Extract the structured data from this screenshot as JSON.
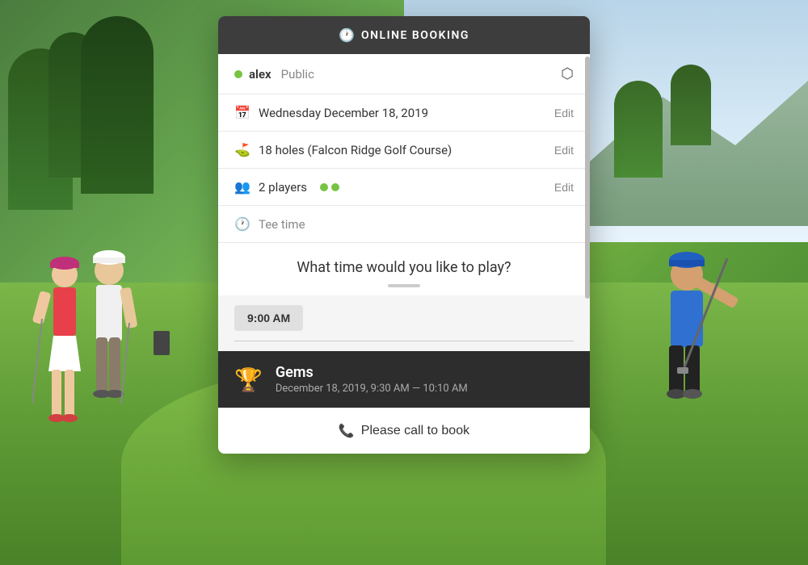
{
  "background": {
    "alt": "Golf course background"
  },
  "modal": {
    "header": {
      "icon": "🕐",
      "title": "ONLINE BOOKING"
    },
    "user": {
      "name": "alex",
      "type": "Public",
      "dot_color": "#76c442"
    },
    "date_row": {
      "icon": "📅",
      "value": "Wednesday December 18, 2019",
      "edit_label": "Edit"
    },
    "holes_row": {
      "icon": "⛳",
      "value": "18 holes (Falcon Ridge Golf Course)",
      "edit_label": "Edit"
    },
    "players_row": {
      "icon": "👥",
      "value": "2 players",
      "dots_count": 2,
      "edit_label": "Edit"
    },
    "tee_time_row": {
      "icon": "🕐",
      "value": "Tee time"
    },
    "question": "What time would you like to play?",
    "time_selector": {
      "selected_time": "9:00 AM"
    },
    "booking_card": {
      "icon": "🏆",
      "name": "Gems",
      "time": "December 18, 2019, 9:30 AM — 10:10 AM"
    },
    "call_button": {
      "icon": "📞",
      "label": "Please call to book"
    }
  }
}
